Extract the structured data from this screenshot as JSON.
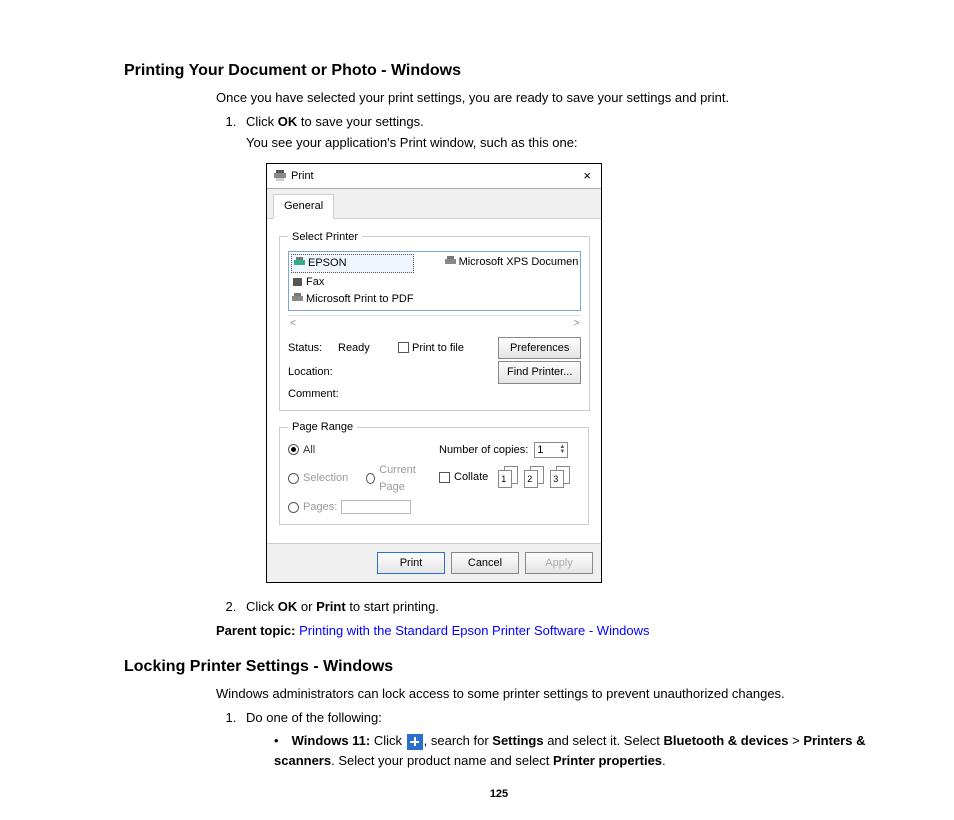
{
  "section1": {
    "heading": "Printing Your Document or Photo - Windows",
    "intro": "Once you have selected your print settings, you are ready to save your settings and print.",
    "step1_a": "Click ",
    "step1_b": "OK",
    "step1_c": " to save your settings.",
    "step1_sub": "You see your application's Print window, such as this one:",
    "step2_a": "Click ",
    "step2_b": "OK",
    "step2_c": " or ",
    "step2_d": "Print",
    "step2_e": " to start printing.",
    "parent_label": "Parent topic:",
    "parent_link": "Printing with the Standard Epson Printer Software - Windows"
  },
  "dialog": {
    "title": "Print",
    "close": "×",
    "tab": "General",
    "select_printer_legend": "Select Printer",
    "printers": {
      "epson": "EPSON",
      "fax": "Fax",
      "mpdf": "Microsoft Print to PDF",
      "mxps": "Microsoft XPS Documen"
    },
    "scroll_left": "<",
    "scroll_right": ">",
    "status_label": "Status:",
    "status_value": "Ready",
    "location_label": "Location:",
    "comment_label": "Comment:",
    "print_to_file": "Print to file",
    "preferences": "Preferences",
    "find_printer": "Find Printer...",
    "page_range_legend": "Page Range",
    "radio_all": "All",
    "radio_selection": "Selection",
    "radio_current": "Current Page",
    "radio_pages": "Pages:",
    "copies_label": "Number of copies:",
    "copies_value": "1",
    "collate": "Collate",
    "pair1": "1",
    "pair2": "2",
    "pair3": "3",
    "btn_print": "Print",
    "btn_cancel": "Cancel",
    "btn_apply": "Apply"
  },
  "section2": {
    "heading": "Locking Printer Settings - Windows",
    "intro": "Windows administrators can lock access to some printer settings to prevent unauthorized changes.",
    "step1": "Do one of the following:",
    "bullet_w11_a": "Windows 11:",
    "bullet_w11_b": " Click ",
    "bullet_w11_c": ", search for ",
    "bullet_w11_d": "Settings",
    "bullet_w11_e": " and select it. Select ",
    "bullet_w11_f": "Bluetooth & devices",
    "bullet_w11_g": " > ",
    "bullet_w11_h": "Printers & scanners",
    "bullet_w11_i": ". Select your product name and select ",
    "bullet_w11_j": "Printer properties",
    "bullet_w11_k": "."
  },
  "page_number": "125"
}
